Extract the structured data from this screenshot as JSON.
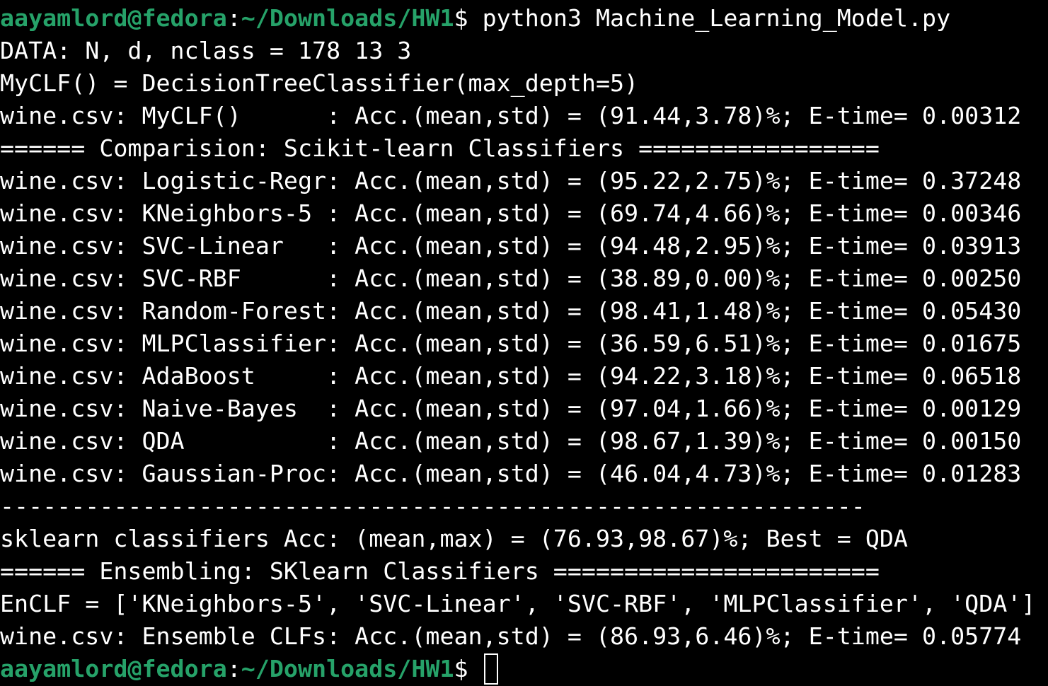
{
  "colors": {
    "background": "#000000",
    "text": "#ffffff",
    "prompt_green": "#26a269"
  },
  "prompt": {
    "user_host": "aayamlord@fedora",
    "separator": ":",
    "path": "~/Downloads/HW1",
    "symbol": "$ ",
    "command": "python3 Machine_Learning_Model.py"
  },
  "output": [
    "DATA: N, d, nclass = 178 13 3",
    "MyCLF() = DecisionTreeClassifier(max_depth=5)",
    "wine.csv: MyCLF()      : Acc.(mean,std) = (91.44,3.78)%; E-time= 0.00312",
    "====== Comparision: Scikit-learn Classifiers =================",
    "wine.csv: Logistic-Regr: Acc.(mean,std) = (95.22,2.75)%; E-time= 0.37248",
    "wine.csv: KNeighbors-5 : Acc.(mean,std) = (69.74,4.66)%; E-time= 0.00346",
    "wine.csv: SVC-Linear   : Acc.(mean,std) = (94.48,2.95)%; E-time= 0.03913",
    "wine.csv: SVC-RBF      : Acc.(mean,std) = (38.89,0.00)%; E-time= 0.00250",
    "wine.csv: Random-Forest: Acc.(mean,std) = (98.41,1.48)%; E-time= 0.05430",
    "wine.csv: MLPClassifier: Acc.(mean,std) = (36.59,6.51)%; E-time= 0.01675",
    "wine.csv: AdaBoost     : Acc.(mean,std) = (94.22,3.18)%; E-time= 0.06518",
    "wine.csv: Naive-Bayes  : Acc.(mean,std) = (97.04,1.66)%; E-time= 0.00129",
    "wine.csv: QDA          : Acc.(mean,std) = (98.67,1.39)%; E-time= 0.00150",
    "wine.csv: Gaussian-Proc: Acc.(mean,std) = (46.04,4.73)%; E-time= 0.01283",
    "-------------------------------------------------------------",
    "sklearn classifiers Acc: (mean,max) = (76.93,98.67)%; Best = QDA",
    "====== Ensembling: SKlearn Classifiers =======================",
    "EnCLF = ['KNeighbors-5', 'SVC-Linear', 'SVC-RBF', 'MLPClassifier', 'QDA']",
    "wine.csv: Ensemble CLFs: Acc.(mean,std) = (86.93,6.46)%; E-time= 0.05774"
  ]
}
